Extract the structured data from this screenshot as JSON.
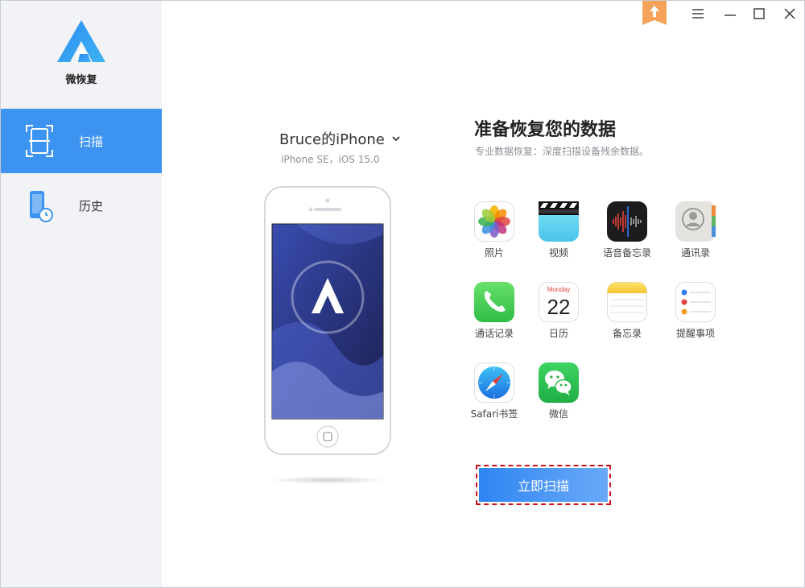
{
  "app": {
    "name": "微恢复"
  },
  "sidebar": {
    "items": [
      {
        "label": "扫描",
        "active": true
      },
      {
        "label": "历史",
        "active": false
      }
    ]
  },
  "device": {
    "name": "Bruce的iPhone",
    "model": "iPhone SE，iOS 15.0"
  },
  "main": {
    "heading": "准备恢复您的数据",
    "subheading": "专业数据恢复：深度扫描设备残余数据。",
    "categories": [
      {
        "label": "照片",
        "icon": "photos-icon"
      },
      {
        "label": "视频",
        "icon": "videos-icon"
      },
      {
        "label": "语音备忘录",
        "icon": "voice-memos-icon"
      },
      {
        "label": "通讯录",
        "icon": "contacts-icon"
      },
      {
        "label": "通话记录",
        "icon": "phone-icon"
      },
      {
        "label": "日历",
        "icon": "calendar-icon"
      },
      {
        "label": "备忘录",
        "icon": "notes-icon"
      },
      {
        "label": "提醒事项",
        "icon": "reminders-icon"
      },
      {
        "label": "Safari书签",
        "icon": "safari-icon"
      },
      {
        "label": "微信",
        "icon": "wechat-icon"
      }
    ],
    "calendar_icon": {
      "weekday": "Monday",
      "day": "22"
    },
    "scan_button": "立即扫描"
  },
  "colors": {
    "accent": "#3d94f0",
    "highlight_border": "#d0101c"
  }
}
